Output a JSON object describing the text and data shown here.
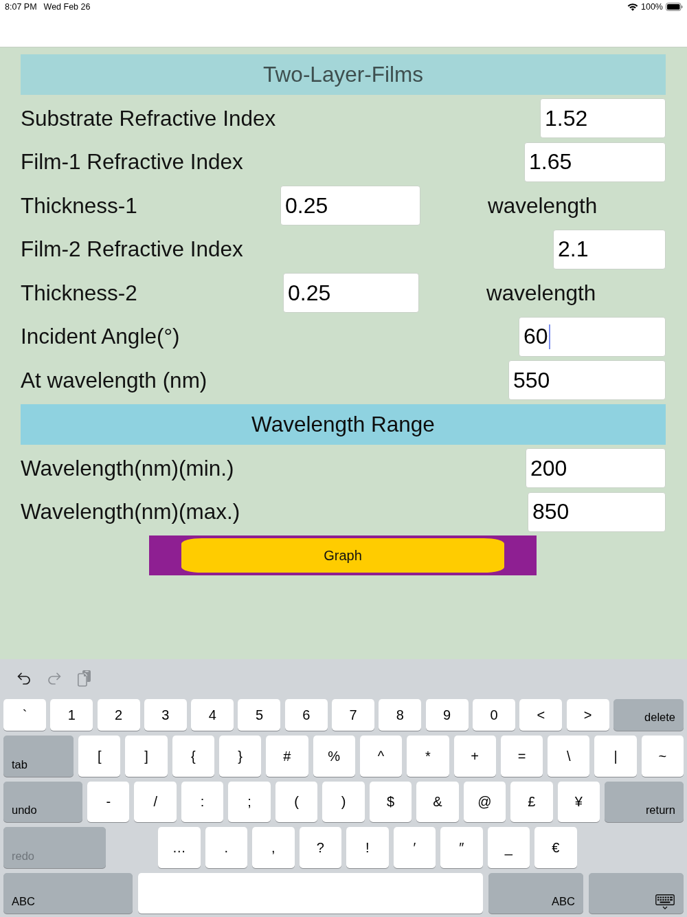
{
  "status_bar": {
    "time": "8:07 PM",
    "date": "Wed Feb 26",
    "battery": "100%"
  },
  "title": "Two-Layer-Films",
  "fields": [
    {
      "kind": "value",
      "label": "Substrate Refractive Index",
      "value": "1.52",
      "focused": false
    },
    {
      "kind": "value",
      "label": "Film-1 Refractive Index",
      "value": "1.65",
      "focused": false
    },
    {
      "kind": "thickness",
      "label": "Thickness-1",
      "value": "0.25",
      "unit": "wavelength",
      "focused": false
    },
    {
      "kind": "value",
      "label": "Film-2 Refractive Index",
      "value": "2.1",
      "focused": false
    },
    {
      "kind": "thickness",
      "label": "Thickness-2",
      "value": "0.25",
      "unit": "wavelength",
      "focused": false
    },
    {
      "kind": "value",
      "label": "Incident Angle(°)",
      "value": "60",
      "focused": true
    },
    {
      "kind": "value",
      "label": "At wavelength (nm)",
      "value": "550",
      "focused": false
    }
  ],
  "range_section": {
    "title": "Wavelength Range",
    "fields": [
      {
        "kind": "value",
        "label": "Wavelength(nm)(min.)",
        "value": "200",
        "focused": false
      },
      {
        "kind": "value",
        "label": "Wavelength(nm)(max.)",
        "value": "850",
        "focused": false
      }
    ]
  },
  "graph_button": {
    "label": "Graph"
  },
  "keyboard": {
    "toolbar": [
      {
        "kind": "undo",
        "disabled": false
      },
      {
        "kind": "redo",
        "disabled": true
      },
      {
        "kind": "paste",
        "disabled": true
      }
    ],
    "rows": [
      {
        "keys": [
          {
            "kind": "char",
            "label": "`"
          },
          {
            "kind": "char",
            "label": "1"
          },
          {
            "kind": "char",
            "label": "2"
          },
          {
            "kind": "char",
            "label": "3"
          },
          {
            "kind": "char",
            "label": "4"
          },
          {
            "kind": "char",
            "label": "5"
          },
          {
            "kind": "char",
            "label": "6"
          },
          {
            "kind": "char",
            "label": "7"
          },
          {
            "kind": "char",
            "label": "8"
          },
          {
            "kind": "char",
            "label": "9"
          },
          {
            "kind": "char",
            "label": "0"
          },
          {
            "kind": "char",
            "label": "<"
          },
          {
            "kind": "char",
            "label": ">"
          },
          {
            "kind": "action",
            "label": "delete",
            "disabled": false
          }
        ]
      },
      {
        "keys": [
          {
            "kind": "action",
            "label": "tab",
            "disabled": false
          },
          {
            "kind": "char",
            "label": "["
          },
          {
            "kind": "char",
            "label": "]"
          },
          {
            "kind": "char",
            "label": "{"
          },
          {
            "kind": "char",
            "label": "}"
          },
          {
            "kind": "char",
            "label": "#"
          },
          {
            "kind": "char",
            "label": "%"
          },
          {
            "kind": "char",
            "label": "^"
          },
          {
            "kind": "char",
            "label": "*"
          },
          {
            "kind": "char",
            "label": "+"
          },
          {
            "kind": "char",
            "label": "="
          },
          {
            "kind": "char",
            "label": "\\"
          },
          {
            "kind": "char",
            "label": "|"
          },
          {
            "kind": "char",
            "label": "~"
          }
        ]
      },
      {
        "keys": [
          {
            "kind": "action",
            "label": "undo",
            "disabled": false
          },
          {
            "kind": "char",
            "label": "-"
          },
          {
            "kind": "char",
            "label": "/"
          },
          {
            "kind": "char",
            "label": ":"
          },
          {
            "kind": "char",
            "label": ";"
          },
          {
            "kind": "char",
            "label": "("
          },
          {
            "kind": "char",
            "label": ")"
          },
          {
            "kind": "char",
            "label": "$"
          },
          {
            "kind": "char",
            "label": "&"
          },
          {
            "kind": "char",
            "label": "@"
          },
          {
            "kind": "char",
            "label": "£"
          },
          {
            "kind": "char",
            "label": "¥"
          },
          {
            "kind": "action",
            "label": "return",
            "disabled": false
          }
        ]
      },
      {
        "keys": [
          {
            "kind": "action",
            "label": "redo",
            "disabled": true
          },
          {
            "kind": "char",
            "label": "…"
          },
          {
            "kind": "char",
            "label": "."
          },
          {
            "kind": "char",
            "label": ","
          },
          {
            "kind": "char",
            "label": "?"
          },
          {
            "kind": "char",
            "label": "!"
          },
          {
            "kind": "char",
            "label": "′"
          },
          {
            "kind": "char",
            "label": "″"
          },
          {
            "kind": "char",
            "label": "_"
          },
          {
            "kind": "char",
            "label": "€"
          }
        ]
      },
      {
        "keys": [
          {
            "kind": "action",
            "label": "ABC",
            "disabled": false
          },
          {
            "kind": "space"
          },
          {
            "kind": "action",
            "label": "ABC",
            "disabled": false
          },
          {
            "kind": "hide"
          }
        ]
      }
    ]
  }
}
